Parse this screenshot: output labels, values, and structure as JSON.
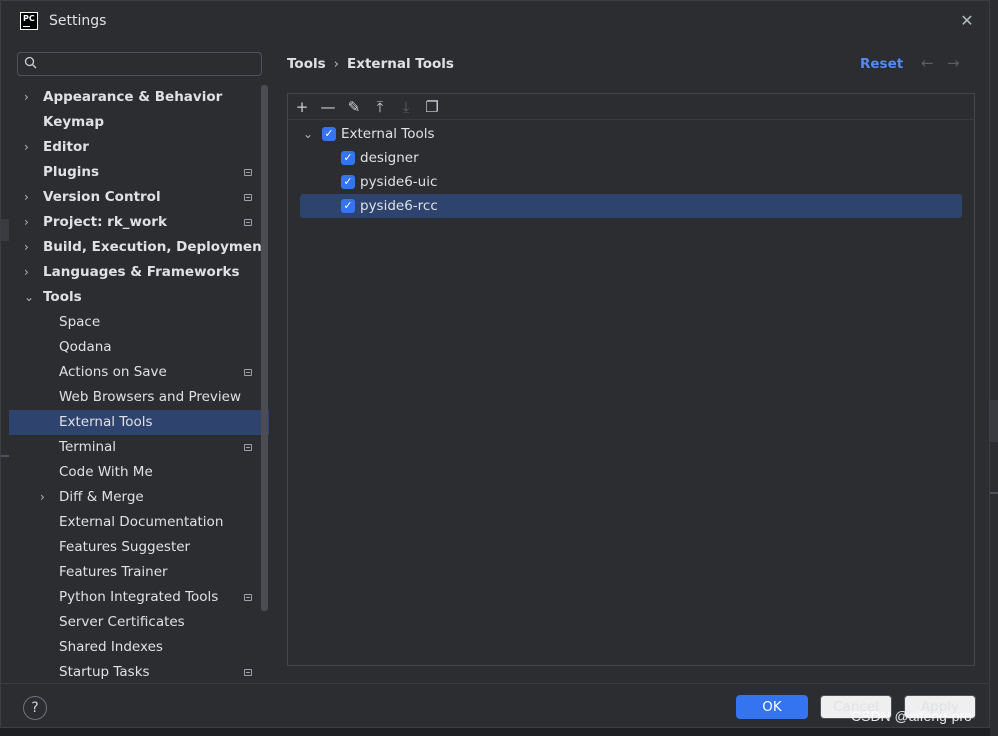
{
  "window": {
    "title": "Settings",
    "logo_text": "PC"
  },
  "search": {
    "placeholder": "",
    "value": ""
  },
  "sidebar": {
    "items": [
      {
        "label": "Appearance & Behavior",
        "level": 0,
        "chevron": "right",
        "badge": false
      },
      {
        "label": "Keymap",
        "level": 0,
        "chevron": "none",
        "badge": false
      },
      {
        "label": "Editor",
        "level": 0,
        "chevron": "right",
        "badge": false
      },
      {
        "label": "Plugins",
        "level": 0,
        "chevron": "none",
        "badge": true
      },
      {
        "label": "Version Control",
        "level": 0,
        "chevron": "right",
        "badge": true
      },
      {
        "label": "Project: rk_work",
        "level": 0,
        "chevron": "right",
        "badge": true
      },
      {
        "label": "Build, Execution, Deployment",
        "level": 0,
        "chevron": "right",
        "badge": false
      },
      {
        "label": "Languages & Frameworks",
        "level": 0,
        "chevron": "right",
        "badge": false
      },
      {
        "label": "Tools",
        "level": 0,
        "chevron": "down",
        "badge": false
      },
      {
        "label": "Space",
        "level": 1,
        "chevron": "none",
        "badge": false
      },
      {
        "label": "Qodana",
        "level": 1,
        "chevron": "none",
        "badge": false
      },
      {
        "label": "Actions on Save",
        "level": 1,
        "chevron": "none",
        "badge": true
      },
      {
        "label": "Web Browsers and Preview",
        "level": 1,
        "chevron": "none",
        "badge": false
      },
      {
        "label": "External Tools",
        "level": 1,
        "chevron": "none",
        "badge": false,
        "selected": true
      },
      {
        "label": "Terminal",
        "level": 1,
        "chevron": "none",
        "badge": true
      },
      {
        "label": "Code With Me",
        "level": 1,
        "chevron": "none",
        "badge": false
      },
      {
        "label": "Diff & Merge",
        "level": 1,
        "chevron": "right",
        "badge": false
      },
      {
        "label": "External Documentation",
        "level": 1,
        "chevron": "none",
        "badge": false
      },
      {
        "label": "Features Suggester",
        "level": 1,
        "chevron": "none",
        "badge": false
      },
      {
        "label": "Features Trainer",
        "level": 1,
        "chevron": "none",
        "badge": false
      },
      {
        "label": "Python Integrated Tools",
        "level": 1,
        "chevron": "none",
        "badge": true
      },
      {
        "label": "Server Certificates",
        "level": 1,
        "chevron": "none",
        "badge": false
      },
      {
        "label": "Shared Indexes",
        "level": 1,
        "chevron": "none",
        "badge": false
      },
      {
        "label": "Startup Tasks",
        "level": 1,
        "chevron": "none",
        "badge": true
      }
    ]
  },
  "header": {
    "breadcrumb": [
      "Tools",
      "External Tools"
    ],
    "reset_label": "Reset",
    "back_glyph": "←",
    "forward_glyph": "→"
  },
  "toolbar": {
    "buttons": [
      {
        "name": "add-icon",
        "glyph": "+",
        "enabled": true
      },
      {
        "name": "remove-icon",
        "glyph": "—",
        "enabled": true
      },
      {
        "name": "edit-icon",
        "glyph": "✎",
        "enabled": true
      },
      {
        "name": "move-up-icon",
        "glyph": "⤒",
        "enabled": true
      },
      {
        "name": "move-down-icon",
        "glyph": "⤓",
        "enabled": false
      },
      {
        "name": "copy-icon",
        "glyph": "❐",
        "enabled": true
      }
    ]
  },
  "tools": {
    "root": {
      "label": "External Tools",
      "checked": true,
      "expanded": true
    },
    "children": [
      {
        "label": "designer",
        "checked": true,
        "selected": false
      },
      {
        "label": "pyside6-uic",
        "checked": true,
        "selected": false
      },
      {
        "label": "pyside6-rcc",
        "checked": true,
        "selected": true
      }
    ]
  },
  "footer": {
    "help_glyph": "?",
    "ok_label": "OK",
    "cancel_label": "Cancel",
    "apply_label": "Apply"
  },
  "watermark": "CSDN @aifeng-pro",
  "colors": {
    "accent": "#3574f0",
    "selection": "#2e436e",
    "link": "#548af7",
    "background": "#2b2d30"
  }
}
